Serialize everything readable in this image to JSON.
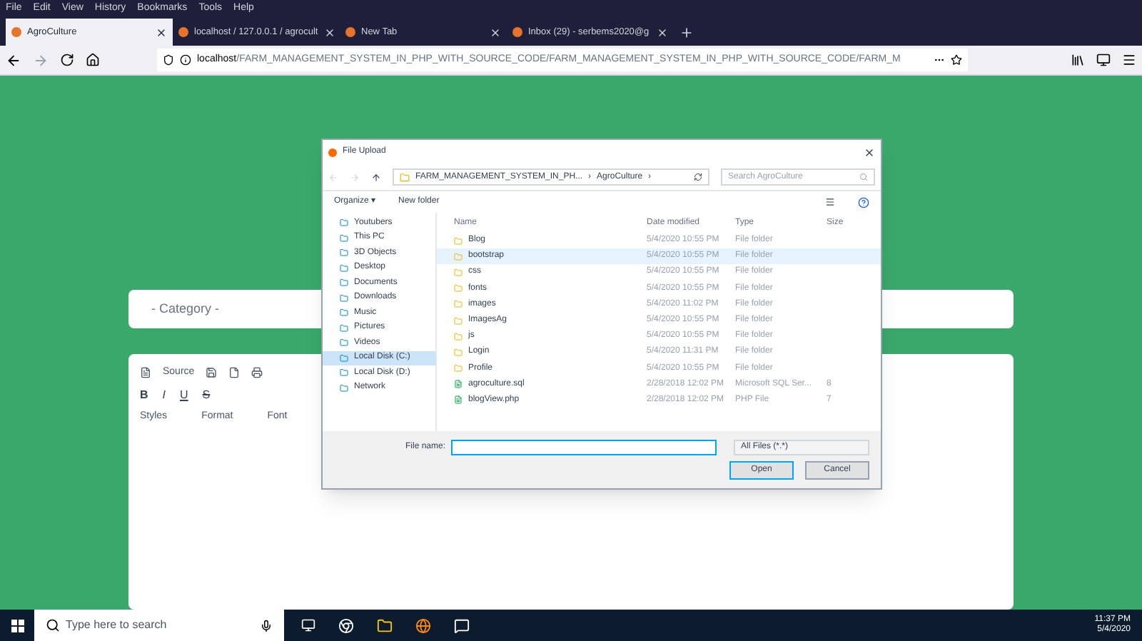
{
  "menu_bar": [
    "File",
    "Edit",
    "View",
    "History",
    "Bookmarks",
    "Tools",
    "Help"
  ],
  "tabs": [
    {
      "label": "AgroCulture",
      "selected": true
    },
    {
      "label": "localhost / 127.0.0.1 / agrocult",
      "selected": false
    },
    {
      "label": "New Tab",
      "selected": false
    },
    {
      "label": "Inbox (29) - serbems2020@g",
      "selected": false
    }
  ],
  "address": {
    "host": "localhost",
    "path": "/FARM_MANAGEMENT_SYSTEM_IN_PHP_WITH_SOURCE_CODE/FARM_MANAGEMENT_SYSTEM_IN_PHP_WITH_SOURCE_CODE/FARM_M"
  },
  "page": {
    "category": {
      "placeholder": "- Category -"
    },
    "editor": {
      "toolbar_row_1": [
        "Source"
      ],
      "toolbar_row_2": [
        "B",
        "I",
        "U",
        "S"
      ],
      "dropdowns": [
        "Styles",
        "Format",
        "Font"
      ]
    }
  },
  "dialog": {
    "title": "File Upload",
    "breadcrumb": [
      "FARM_MANAGEMENT_SYSTEM_IN_PH...",
      "›",
      "AgroCulture",
      "›"
    ],
    "search": {
      "placeholder": "Search AgroCulture"
    },
    "toolbar": [
      "Organize ▾",
      "New folder"
    ],
    "sidebar": [
      {
        "label": "Youtubers",
        "selected": false
      },
      {
        "label": "This PC",
        "selected": false
      },
      {
        "label": "3D Objects",
        "selected": false
      },
      {
        "label": "Desktop",
        "selected": false
      },
      {
        "label": "Documents",
        "selected": false
      },
      {
        "label": "Downloads",
        "selected": false
      },
      {
        "label": "Music",
        "selected": false
      },
      {
        "label": "Pictures",
        "selected": false
      },
      {
        "label": "Videos",
        "selected": false
      },
      {
        "label": "Local Disk (C:)",
        "selected": true
      },
      {
        "label": "Local Disk (D:)",
        "selected": false
      },
      {
        "label": "Network",
        "selected": false
      }
    ],
    "columns": [
      "Name",
      "Date modified",
      "Type",
      "Size"
    ],
    "files": [
      {
        "kind": "folder",
        "name": "Blog",
        "date": "5/4/2020 10:55 PM",
        "type": "File folder",
        "selected": false
      },
      {
        "kind": "folder",
        "name": "bootstrap",
        "date": "5/4/2020 10:55 PM",
        "type": "File folder",
        "selected": true
      },
      {
        "kind": "folder",
        "name": "css",
        "date": "5/4/2020 10:55 PM",
        "type": "File folder",
        "selected": false
      },
      {
        "kind": "folder",
        "name": "fonts",
        "date": "5/4/2020 10:55 PM",
        "type": "File folder",
        "selected": false
      },
      {
        "kind": "folder",
        "name": "images",
        "date": "5/4/2020 11:02 PM",
        "type": "File folder",
        "selected": false
      },
      {
        "kind": "folder",
        "name": "ImagesAg",
        "date": "5/4/2020 10:55 PM",
        "type": "File folder",
        "selected": false
      },
      {
        "kind": "folder",
        "name": "js",
        "date": "5/4/2020 10:55 PM",
        "type": "File folder",
        "selected": false
      },
      {
        "kind": "folder",
        "name": "Login",
        "date": "5/4/2020 11:31 PM",
        "type": "File folder",
        "selected": false
      },
      {
        "kind": "folder",
        "name": "Profile",
        "date": "5/4/2020 10:55 PM",
        "type": "File folder",
        "selected": false
      },
      {
        "kind": "file",
        "name": "agroculture.sql",
        "date": "2/28/2018 12:02 PM",
        "type": "Microsoft SQL Ser...",
        "size": "8",
        "selected": false
      },
      {
        "kind": "file",
        "name": "blogView.php",
        "date": "2/28/2018 12:02 PM",
        "type": "PHP File",
        "size": "7",
        "selected": false
      }
    ],
    "file_name_label": "File name:",
    "filter": "All Files (*.*)",
    "buttons": [
      "Open",
      "Cancel"
    ]
  },
  "taskbar": {
    "search": {
      "placeholder": "Type here to search"
    },
    "time": "11:37 PM",
    "date": "5/4/2020"
  }
}
